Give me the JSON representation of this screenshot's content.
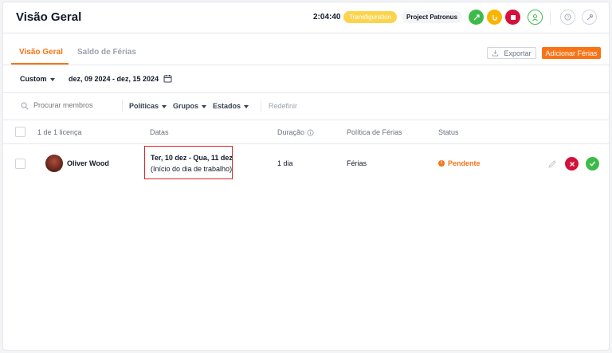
{
  "header": {
    "title": "Visão Geral",
    "timer": "2:04:40",
    "task_badge": "Transfiguration",
    "project_badge": "Project Patronus"
  },
  "tabs": [
    {
      "label": "Visão Geral",
      "active": true
    },
    {
      "label": "Saldo de Férias",
      "active": false
    }
  ],
  "actions": {
    "export_label": "Exportar",
    "add_label": "Adicionar Férias"
  },
  "date_filter": {
    "mode": "Custom",
    "range": "dez, 09 2024 - dez, 15 2024"
  },
  "filters": {
    "search_placeholder": "Procurar membros",
    "policies": "Políticas",
    "groups": "Grupos",
    "states": "Estados",
    "reset": "Redefinir"
  },
  "table": {
    "headers": {
      "count": "1 de 1 licença",
      "dates": "Datas",
      "duration": "Duração",
      "policy": "Política de Férias",
      "status": "Status"
    },
    "rows": [
      {
        "name": "Oliver Wood",
        "dates_line1": "Ter, 10 dez - Qua, 11 dez",
        "dates_line2": "(Início do dia de trabalho)",
        "duration": "1 dia",
        "policy": "Férias",
        "status": "Pendente"
      }
    ]
  },
  "colors": {
    "accent": "#f97316",
    "success": "#3dbb4a",
    "danger": "#d5103b",
    "highlight_box": "#dc2626"
  },
  "icons": [
    "add-time-icon",
    "coffee-break-icon",
    "stop-icon",
    "user-status-icon",
    "help-icon",
    "settings-icon",
    "download-icon",
    "calendar-icon",
    "search-icon",
    "info-icon",
    "pencil-icon",
    "close-icon",
    "check-icon"
  ]
}
